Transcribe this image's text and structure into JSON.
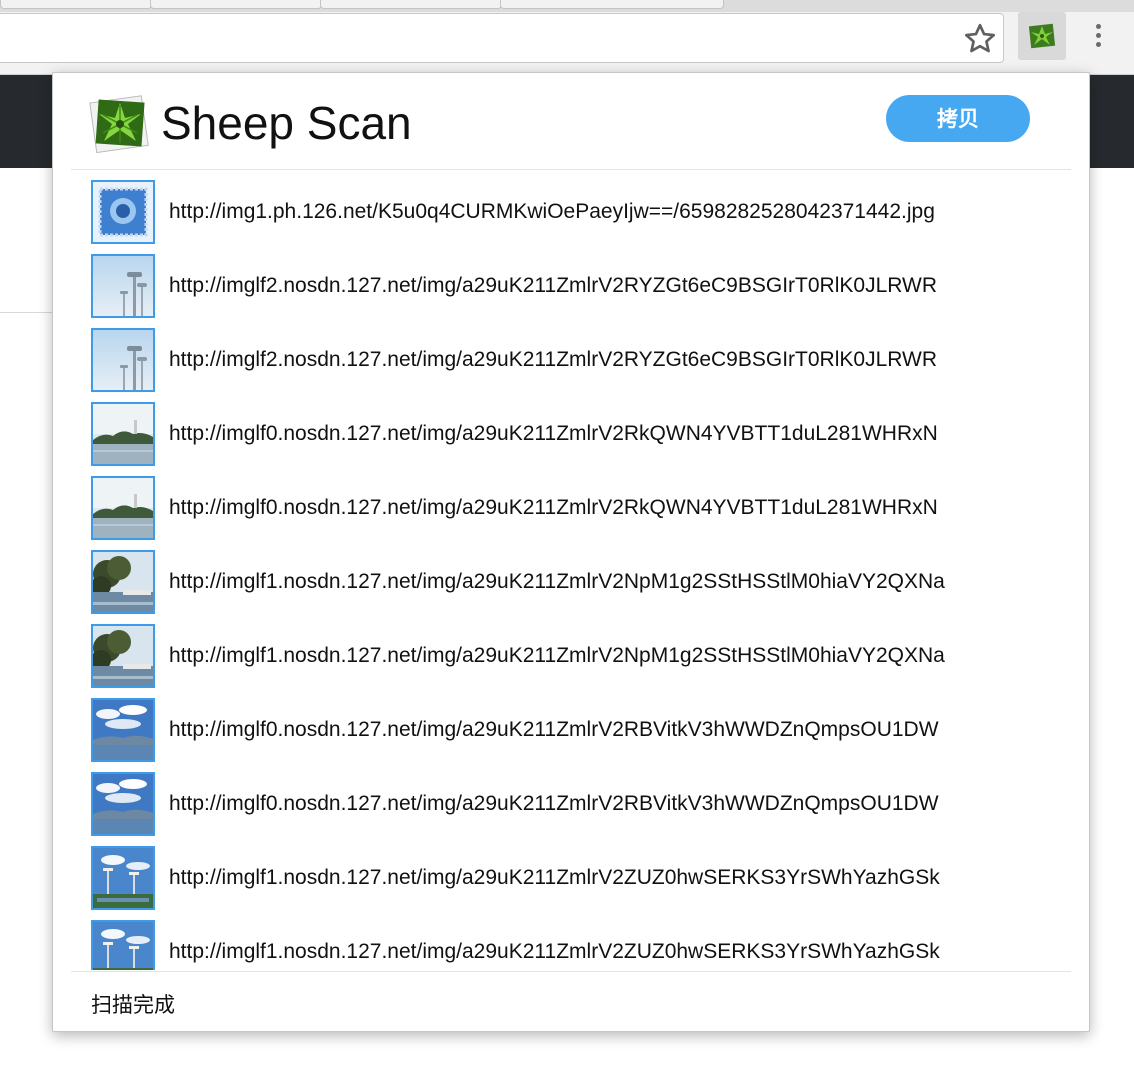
{
  "browser": {
    "star_icon": "star-outline-icon",
    "extension_icon": "sheep-scan-leaf-icon",
    "menu_icon": "vertical-dots-icon"
  },
  "popup": {
    "title": "Sheep Scan",
    "copy_label": "拷贝",
    "status": "扫描完成",
    "accent_color": "#47a8f2",
    "items": [
      {
        "url": "http://img1.ph.126.net/K5u0q4CURMKwiOePaeyIjw==/6598282528042371442.jpg",
        "thumb": "blue-stamp"
      },
      {
        "url": "http://imglf2.nosdn.127.net/img/a29uK211ZmlrV2RYZGt6eC9BSGIrT0RlK0JLRWR",
        "thumb": "tower"
      },
      {
        "url": "http://imglf2.nosdn.127.net/img/a29uK211ZmlrV2RYZGt6eC9BSGIrT0RlK0JLRWR",
        "thumb": "tower"
      },
      {
        "url": "http://imglf0.nosdn.127.net/img/a29uK211ZmlrV2RkQWN4YVBTT1duL281WHRxN",
        "thumb": "lake"
      },
      {
        "url": "http://imglf0.nosdn.127.net/img/a29uK211ZmlrV2RkQWN4YVBTT1duL281WHRxN",
        "thumb": "lake"
      },
      {
        "url": "http://imglf1.nosdn.127.net/img/a29uK211ZmlrV2NpM1g2SStHSStlM0hiaVY2QXNa",
        "thumb": "trees"
      },
      {
        "url": "http://imglf1.nosdn.127.net/img/a29uK211ZmlrV2NpM1g2SStHSStlM0hiaVY2QXNa",
        "thumb": "trees"
      },
      {
        "url": "http://imglf0.nosdn.127.net/img/a29uK211ZmlrV2RBVitkV3hWWDZnQmpsOU1DW",
        "thumb": "sky"
      },
      {
        "url": "http://imglf0.nosdn.127.net/img/a29uK211ZmlrV2RBVitkV3hWWDZnQmpsOU1DW",
        "thumb": "sky"
      },
      {
        "url": "http://imglf1.nosdn.127.net/img/a29uK211ZmlrV2ZUZ0hwSERKS3YrSWhYazhGSk",
        "thumb": "city"
      },
      {
        "url": "http://imglf1.nosdn.127.net/img/a29uK211ZmlrV2ZUZ0hwSERKS3YrSWhYazhGSk",
        "thumb": "city"
      }
    ]
  }
}
